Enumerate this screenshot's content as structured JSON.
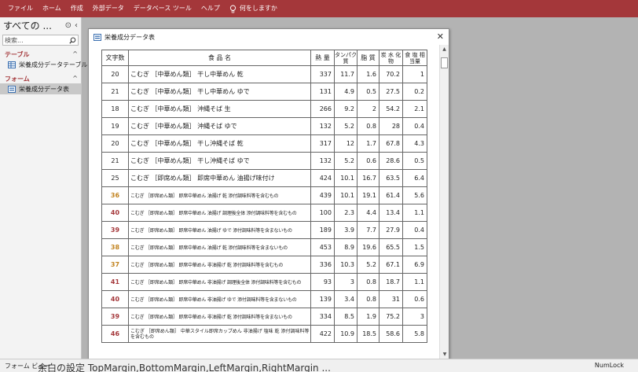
{
  "ribbon": {
    "tabs": [
      "ファイル",
      "ホーム",
      "作成",
      "外部データ",
      "データベース ツール",
      "ヘルプ"
    ],
    "tell_me": "何をしますか"
  },
  "nav": {
    "title": "すべての ...",
    "search_placeholder": "検索...",
    "groups": [
      {
        "label": "テーブル",
        "items": [
          {
            "label": "栄養成分データテーブル"
          }
        ]
      },
      {
        "label": "フォーム",
        "items": [
          {
            "label": "栄養成分データ表"
          }
        ]
      }
    ]
  },
  "form": {
    "title": "栄養成分データ表",
    "headers": {
      "count": "文字数",
      "name": "食 品 名",
      "energy": "熱 量",
      "protein": "タンパク質",
      "fat": "脂 質",
      "carb": "炭 水 化 物",
      "salt": "食 塩 相当量"
    }
  },
  "rows": [
    {
      "count": "20",
      "name": "こむぎ ［中華めん類］ 干し中華めん 乾",
      "energy": "337",
      "protein": "11.7",
      "fat": "1.6",
      "carb": "70.2",
      "salt": "1"
    },
    {
      "count": "21",
      "name": "こむぎ ［中華めん類］ 干し中華めん ゆで",
      "energy": "131",
      "protein": "4.9",
      "fat": "0.5",
      "carb": "27.5",
      "salt": "0.2"
    },
    {
      "count": "18",
      "name": "こむぎ ［中華めん類］ 沖縄そば 生",
      "energy": "266",
      "protein": "9.2",
      "fat": "2",
      "carb": "54.2",
      "salt": "2.1"
    },
    {
      "count": "19",
      "name": "こむぎ ［中華めん類］ 沖縄そば ゆで",
      "energy": "132",
      "protein": "5.2",
      "fat": "0.8",
      "carb": "28",
      "salt": "0.4"
    },
    {
      "count": "20",
      "name": "こむぎ ［中華めん類］ 干し沖縄そば 乾",
      "energy": "317",
      "protein": "12",
      "fat": "1.7",
      "carb": "67.8",
      "salt": "4.3"
    },
    {
      "count": "21",
      "name": "こむぎ ［中華めん類］ 干し沖縄そば ゆで",
      "energy": "132",
      "protein": "5.2",
      "fat": "0.6",
      "carb": "28.6",
      "salt": "0.5"
    },
    {
      "count": "25",
      "name": "こむぎ ［即席めん類］ 即席中華めん 油揚げ味付け",
      "energy": "424",
      "protein": "10.1",
      "fat": "16.7",
      "carb": "63.5",
      "salt": "6.4"
    },
    {
      "count": "36",
      "name": "こむぎ ［即席めん類］ 即席中華めん 油揚げ 乾 添付調味料等を含むもの",
      "energy": "439",
      "protein": "10.1",
      "fat": "19.1",
      "carb": "61.4",
      "salt": "5.6"
    },
    {
      "count": "40",
      "name": "こむぎ ［即席めん類］ 即席中華めん 油揚げ 調理後全体 添付調味料等を含むもの",
      "energy": "100",
      "protein": "2.3",
      "fat": "4.4",
      "carb": "13.4",
      "salt": "1.1"
    },
    {
      "count": "39",
      "name": "こむぎ ［即席めん類］ 即席中華めん 油揚げ ゆで 添付調味料等を含まないもの",
      "energy": "189",
      "protein": "3.9",
      "fat": "7.7",
      "carb": "27.9",
      "salt": "0.4"
    },
    {
      "count": "38",
      "name": "こむぎ ［即席めん類］ 即席中華めん 油揚げ 乾 添付調味料等を含まないもの",
      "energy": "453",
      "protein": "8.9",
      "fat": "19.6",
      "carb": "65.5",
      "salt": "1.5"
    },
    {
      "count": "37",
      "name": "こむぎ ［即席めん類］ 即席中華めん 非油揚げ 乾 添付調味料等を含むもの",
      "energy": "336",
      "protein": "10.3",
      "fat": "5.2",
      "carb": "67.1",
      "salt": "6.9"
    },
    {
      "count": "41",
      "name": "こむぎ ［即席めん類］ 即席中華めん 非油揚げ 調理後全体 添付調味料等を含むもの",
      "energy": "93",
      "protein": "3",
      "fat": "0.8",
      "carb": "18.7",
      "salt": "1.1"
    },
    {
      "count": "40",
      "name": "こむぎ ［即席めん類］ 即席中華めん 非油揚げ ゆで 添付調味料等を含まないもの",
      "energy": "139",
      "protein": "3.4",
      "fat": "0.8",
      "carb": "31",
      "salt": "0.6"
    },
    {
      "count": "39",
      "name": "こむぎ ［即席めん類］ 即席中華めん 非油揚げ 乾 添付調味料等を含まないもの",
      "energy": "334",
      "protein": "8.5",
      "fat": "1.9",
      "carb": "75.2",
      "salt": "3"
    },
    {
      "count": "46",
      "name": "こむぎ ［即席めん類］ 中華スタイル即席カップめん 非油揚げ 塩味 乾 添付調味料等を含むもの",
      "energy": "422",
      "protein": "10.9",
      "fat": "18.5",
      "carb": "58.6",
      "salt": "5.8"
    }
  ],
  "status": {
    "left": "フォーム ビュー",
    "ghost": "余白の設定 TopMargin,BottomMargin,LeftMargin,RightMargin ...",
    "right": "NumLock"
  },
  "colors": {
    "accent": "#a4373a",
    "count_high": "#a4373a",
    "count_mid": "#c2831f"
  }
}
